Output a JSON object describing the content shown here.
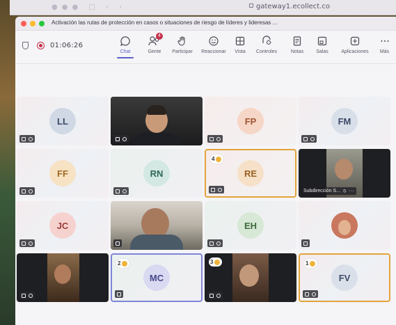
{
  "browser": {
    "url": "gateway1.ecollect.co"
  },
  "window": {
    "title": "Activación las rutas de protección en casos o situaciones de riesgo de líderes y lideresas ..."
  },
  "meeting": {
    "timer": "01:06:26"
  },
  "toolbar": {
    "buttons": [
      {
        "label": "Chat",
        "icon": "chat-icon",
        "active": true
      },
      {
        "label": "Gente",
        "icon": "people-icon",
        "badge": "4"
      },
      {
        "label": "Participar",
        "icon": "raise-hand-icon"
      },
      {
        "label": "Reaccionar",
        "icon": "react-icon"
      },
      {
        "label": "Vista",
        "icon": "grid-view-icon"
      },
      {
        "label": "Controles",
        "icon": "controls-icon"
      },
      {
        "label": "Notas",
        "icon": "notes-icon"
      },
      {
        "label": "Salas",
        "icon": "rooms-icon"
      },
      {
        "label": "Aplicaciones",
        "icon": "apps-icon"
      },
      {
        "label": "Más",
        "icon": "more-icon"
      }
    ]
  },
  "participants": [
    {
      "initials": "LL"
    },
    {
      "type": "video"
    },
    {
      "initials": "FP"
    },
    {
      "initials": "FM"
    },
    {
      "initials": "FF"
    },
    {
      "initials": "RN"
    },
    {
      "initials": "RE",
      "hand": "4"
    },
    {
      "type": "video",
      "name": "Subdirección S..."
    },
    {
      "initials": "JC"
    },
    {
      "type": "video"
    },
    {
      "initials": "EH"
    },
    {
      "type": "video"
    },
    {
      "type": "video"
    },
    {
      "initials": "MC",
      "hand": "2"
    },
    {
      "type": "video",
      "hand": "3"
    },
    {
      "initials": "FV",
      "hand": "1"
    }
  ],
  "colors": {
    "accent": "#5b5fc7",
    "hand_highlight": "#e3a33a",
    "recording": "#c4314b"
  }
}
